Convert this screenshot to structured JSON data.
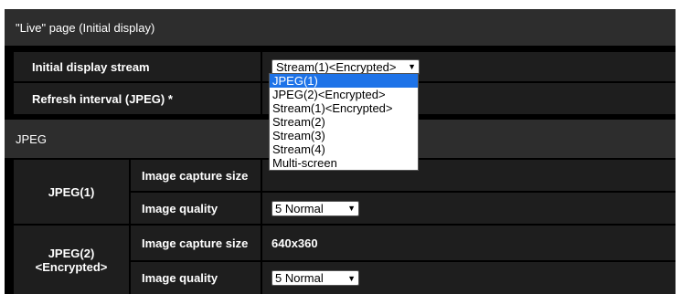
{
  "live_page": {
    "title": "\"Live\" page (Initial display)",
    "initial_stream": {
      "label": "Initial display stream",
      "selected": "Stream(1)<Encrypted>",
      "options": [
        "JPEG(1)",
        "JPEG(2)<Encrypted>",
        "Stream(1)<Encrypted>",
        "Stream(2)",
        "Stream(3)",
        "Stream(4)",
        "Multi-screen"
      ],
      "highlighted_option": "JPEG(1)"
    },
    "refresh_interval": {
      "label": "Refresh interval (JPEG) *"
    }
  },
  "jpeg_section": {
    "title": "JPEG",
    "jpeg1": {
      "label": "JPEG(1)",
      "capture_size_label": "Image capture size",
      "quality_label": "Image quality",
      "quality_value": "5 Normal"
    },
    "jpeg2": {
      "label_line1": "JPEG(2)",
      "label_line2": "<Encrypted>",
      "capture_size_label": "Image capture size",
      "capture_size_value": "640x360",
      "quality_label": "Image quality",
      "quality_value": "5 Normal"
    }
  },
  "icons": {
    "dropdown_arrow": "chevron-down-icon"
  },
  "colors": {
    "section_header_bg": "#2d2d2d",
    "cell_bg": "#1e1e1e",
    "selected_option_bg": "#1e73e8"
  }
}
